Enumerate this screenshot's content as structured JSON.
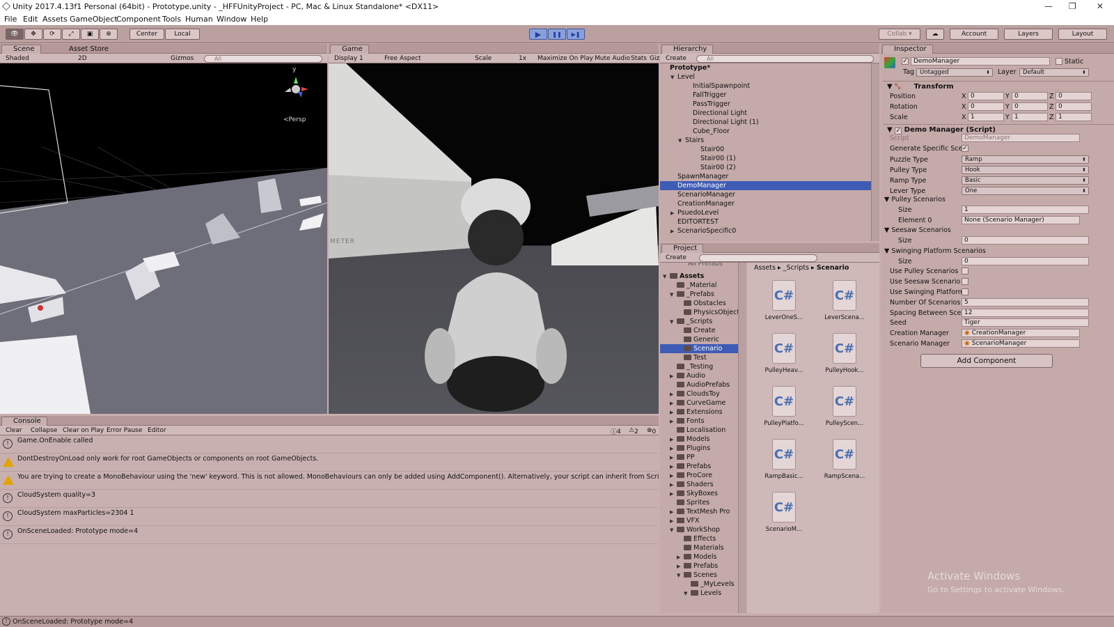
{
  "window": {
    "title": "Unity 2017.4.13f1 Personal (64bit) - Prototype.unity - _HFFUnityProject - PC, Mac & Linux Standalone* <DX11>",
    "min": "—",
    "max": "❐",
    "close": "✕"
  },
  "menu": [
    "File",
    "Edit",
    "Assets",
    "GameObject",
    "Component",
    "Tools",
    "Human",
    "Window",
    "Help"
  ],
  "toolbar": {
    "tools": [
      "👁",
      "✥",
      "⟳",
      "⤢",
      "▣",
      "⊕"
    ],
    "center": "Center",
    "local": "Local",
    "play": "▶",
    "pause": "❚❚",
    "step": "▶❚",
    "collab": "Collab ▾",
    "cloud": "☁",
    "account": "Account",
    "layers": "Layers",
    "layout": "Layout"
  },
  "scene": {
    "tab": "Scene",
    "tab2": "Asset Store",
    "shaded": "Shaded",
    "mode2d": "2D",
    "gizmos": "Gizmos",
    "search": "All",
    "persp": "<Persp",
    "gizmo_y": "y"
  },
  "game": {
    "tab": "Game",
    "display": "Display 1",
    "aspect": "Free Aspect",
    "scale": "Scale",
    "scale_val": "1x",
    "max": "Maximize On Play",
    "mute": "Mute Audio",
    "stats": "Stats",
    "gizmos": "Giz",
    "sign": "METER"
  },
  "hierarchy": {
    "tab": "Hierarchy",
    "create": "Create",
    "search": "All",
    "scene": "Prototype*",
    "rows": [
      {
        "label": "Level",
        "ind": 1,
        "arrow": "▼"
      },
      {
        "label": "InitialSpawnpoint",
        "ind": 3,
        "arrow": ""
      },
      {
        "label": "FallTrigger",
        "ind": 3,
        "arrow": ""
      },
      {
        "label": "PassTrigger",
        "ind": 3,
        "arrow": ""
      },
      {
        "label": "Directional Light",
        "ind": 3,
        "arrow": ""
      },
      {
        "label": "Directional Light (1)",
        "ind": 3,
        "arrow": ""
      },
      {
        "label": "Cube_Floor",
        "ind": 3,
        "arrow": ""
      },
      {
        "label": "Stairs",
        "ind": 2,
        "arrow": "▼"
      },
      {
        "label": "Stair00",
        "ind": 4,
        "arrow": ""
      },
      {
        "label": "Stair00 (1)",
        "ind": 4,
        "arrow": ""
      },
      {
        "label": "Stair00 (2)",
        "ind": 4,
        "arrow": ""
      },
      {
        "label": "SpawnManager",
        "ind": 1,
        "arrow": ""
      },
      {
        "label": "DemoManager",
        "ind": 1,
        "arrow": "",
        "sel": true
      },
      {
        "label": "ScenarioManager",
        "ind": 1,
        "arrow": ""
      },
      {
        "label": "CreationManager",
        "ind": 1,
        "arrow": ""
      },
      {
        "label": "PsuedoLevel",
        "ind": 1,
        "arrow": "▶"
      },
      {
        "label": "EDITORTEST",
        "ind": 1,
        "arrow": ""
      },
      {
        "label": "ScenarioSpecific0",
        "ind": 1,
        "arrow": "▶"
      }
    ]
  },
  "project": {
    "tab": "Project",
    "create": "Create",
    "clipped": "All Prefabs",
    "root": "Assets",
    "crumbs": [
      "Assets",
      "_Scripts",
      "Scenario"
    ],
    "tree": [
      {
        "label": "_Material",
        "ind": 1,
        "arrow": ""
      },
      {
        "label": "_Prefabs",
        "ind": 1,
        "arrow": "▼"
      },
      {
        "label": "Obstacles",
        "ind": 2,
        "arrow": ""
      },
      {
        "label": "PhysicsObjects",
        "ind": 2,
        "arrow": ""
      },
      {
        "label": "_Scripts",
        "ind": 1,
        "arrow": "▼"
      },
      {
        "label": "Create",
        "ind": 2,
        "arrow": ""
      },
      {
        "label": "Generic",
        "ind": 2,
        "arrow": ""
      },
      {
        "label": "Scenario",
        "ind": 2,
        "arrow": "",
        "sel": true
      },
      {
        "label": "Test",
        "ind": 2,
        "arrow": ""
      },
      {
        "label": "_Testing",
        "ind": 1,
        "arrow": ""
      },
      {
        "label": "Audio",
        "ind": 1,
        "arrow": "▶"
      },
      {
        "label": "AudioPrefabs",
        "ind": 1,
        "arrow": ""
      },
      {
        "label": "CloudsToy",
        "ind": 1,
        "arrow": "▶"
      },
      {
        "label": "CurveGame",
        "ind": 1,
        "arrow": "▶"
      },
      {
        "label": "Extensions",
        "ind": 1,
        "arrow": "▶"
      },
      {
        "label": "Fonts",
        "ind": 1,
        "arrow": "▶"
      },
      {
        "label": "Localisation",
        "ind": 1,
        "arrow": ""
      },
      {
        "label": "Models",
        "ind": 1,
        "arrow": "▶"
      },
      {
        "label": "Plugins",
        "ind": 1,
        "arrow": "▶"
      },
      {
        "label": "PP",
        "ind": 1,
        "arrow": "▶"
      },
      {
        "label": "Prefabs",
        "ind": 1,
        "arrow": "▶"
      },
      {
        "label": "ProCore",
        "ind": 1,
        "arrow": "▶"
      },
      {
        "label": "Shaders",
        "ind": 1,
        "arrow": "▶"
      },
      {
        "label": "SkyBoxes",
        "ind": 1,
        "arrow": "▶"
      },
      {
        "label": "Sprites",
        "ind": 1,
        "arrow": ""
      },
      {
        "label": "TextMesh Pro",
        "ind": 1,
        "arrow": "▶"
      },
      {
        "label": "VFX",
        "ind": 1,
        "arrow": "▶"
      },
      {
        "label": "WorkShop",
        "ind": 1,
        "arrow": "▼"
      },
      {
        "label": "Effects",
        "ind": 2,
        "arrow": ""
      },
      {
        "label": "Materials",
        "ind": 2,
        "arrow": ""
      },
      {
        "label": "Models",
        "ind": 2,
        "arrow": "▶"
      },
      {
        "label": "Prefabs",
        "ind": 2,
        "arrow": "▶"
      },
      {
        "label": "Scenes",
        "ind": 2,
        "arrow": "▼"
      },
      {
        "label": "_MyLevels",
        "ind": 3,
        "arrow": ""
      },
      {
        "label": "Levels",
        "ind": 3,
        "arrow": "▼"
      }
    ],
    "assets": [
      "LeverOneS...",
      "LeverScena...",
      "PulleyHeav...",
      "PulleyHook...",
      "PulleyPlatfo...",
      "PulleyScen...",
      "RampBasic...",
      "RampScena...",
      "ScenarioM..."
    ],
    "cs": "C#"
  },
  "inspector": {
    "tab": "Inspector",
    "name": "DemoManager",
    "static": "Static",
    "tag_label": "Tag",
    "tag": "Untagged",
    "layer_label": "Layer",
    "layer": "Default",
    "transform": "Transform",
    "pos": {
      "label": "Position",
      "x": "0",
      "y": "0",
      "z": "0"
    },
    "rot": {
      "label": "Rotation",
      "x": "0",
      "y": "0",
      "z": "0"
    },
    "scale": {
      "label": "Scale",
      "x": "1",
      "y": "1",
      "z": "1"
    },
    "script_comp": "Demo Manager (Script)",
    "script_label": "Script",
    "script_val": "DemoManager",
    "gen": "Generate Specific Sce",
    "puzzle": {
      "label": "Puzzle Type",
      "val": "Ramp"
    },
    "pulley": {
      "label": "Pulley Type",
      "val": "Hook"
    },
    "ramp": {
      "label": "Ramp Type",
      "val": "Basic"
    },
    "lever": {
      "label": "Lever Type",
      "val": "One"
    },
    "ps": "Pulley Scenarios",
    "size": "Size",
    "ps_size": "1",
    "el0": "Element 0",
    "el0_val": "None (Scenario Manager)",
    "ss": "Seesaw Scenarios",
    "ss_size": "0",
    "sps": "Swinging Platform Scenarios",
    "sps_size": "0",
    "use_pulley": "Use Pulley Scenarios",
    "use_seesaw": "Use Seesaw Scenario",
    "use_swing": "Use Swinging Platform",
    "num": {
      "label": "Number Of Scenarios",
      "val": "5"
    },
    "spacing": {
      "label": "Spacing Between Sce",
      "val": "12"
    },
    "seed": {
      "label": "Seed",
      "val": "Tiger"
    },
    "creation": {
      "label": "Creation Manager",
      "val": "CreationManager"
    },
    "scenario": {
      "label": "Scenario Manager",
      "val": "ScenarioManager"
    },
    "add": "Add Component"
  },
  "console": {
    "tab": "Console",
    "clear": "Clear",
    "collapse": "Collapse",
    "clearplay": "Clear on Play",
    "errpause": "Error Pause",
    "editor": "Editor",
    "count_info": "4",
    "count_warn": "2",
    "count_err": "0",
    "lines": [
      {
        "type": "info",
        "text": "Game.OnEnable called"
      },
      {
        "type": "warn",
        "text": "DontDestroyOnLoad only work for root GameObjects or components on root GameObjects."
      },
      {
        "type": "warn",
        "text": "You are trying to create a MonoBehaviour using the 'new' keyword.  This is not allowed.  MonoBehaviours can only be added using AddComponent().  Alternatively, your script can inherit from Scri"
      },
      {
        "type": "info",
        "text": "CloudSystem quality=3"
      },
      {
        "type": "info",
        "text": "CloudSystem maxParticles=2304 1"
      },
      {
        "type": "info",
        "text": "OnSceneLoaded: Prototype  mode=4"
      }
    ]
  },
  "status": "OnSceneLoaded: Prototype  mode=4",
  "watermark": {
    "title": "Activate Windows",
    "sub": "Go to Settings to activate Windows."
  }
}
